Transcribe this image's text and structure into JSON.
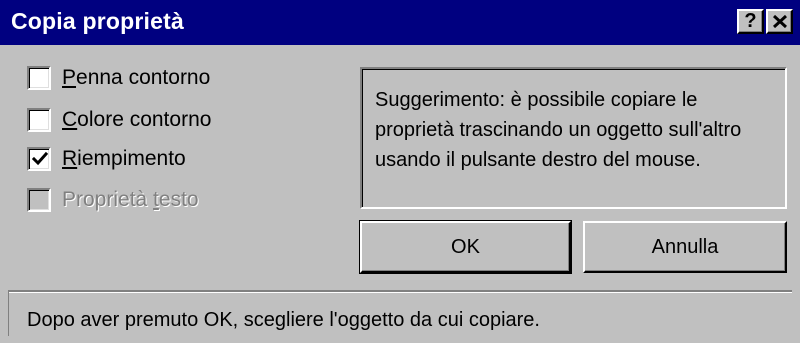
{
  "window": {
    "title": "Copia proprietà",
    "help_label": "?",
    "close_label": "✕"
  },
  "options": [
    {
      "label": "Penna contorno",
      "checked": false,
      "enabled": true,
      "mnemonic": "P"
    },
    {
      "label": "Colore contorno",
      "checked": false,
      "enabled": true,
      "mnemonic": "C"
    },
    {
      "label": "Riempimento",
      "checked": true,
      "enabled": true,
      "mnemonic": "R"
    },
    {
      "label": "Proprietà testo",
      "checked": false,
      "enabled": false,
      "mnemonic": "t"
    }
  ],
  "hint": {
    "text": "Suggerimento: è possibile copiare le proprietà trascinando un oggetto sull'altro usando il pulsante destro del mouse."
  },
  "buttons": {
    "ok_label": "OK",
    "cancel_label": "Annulla"
  },
  "status": {
    "text": "Dopo aver premuto OK, scegliere l'oggetto da cui copiare."
  },
  "colors": {
    "titlebar": "#000080",
    "face": "#c0c0c0",
    "disabled_text": "#808080"
  }
}
